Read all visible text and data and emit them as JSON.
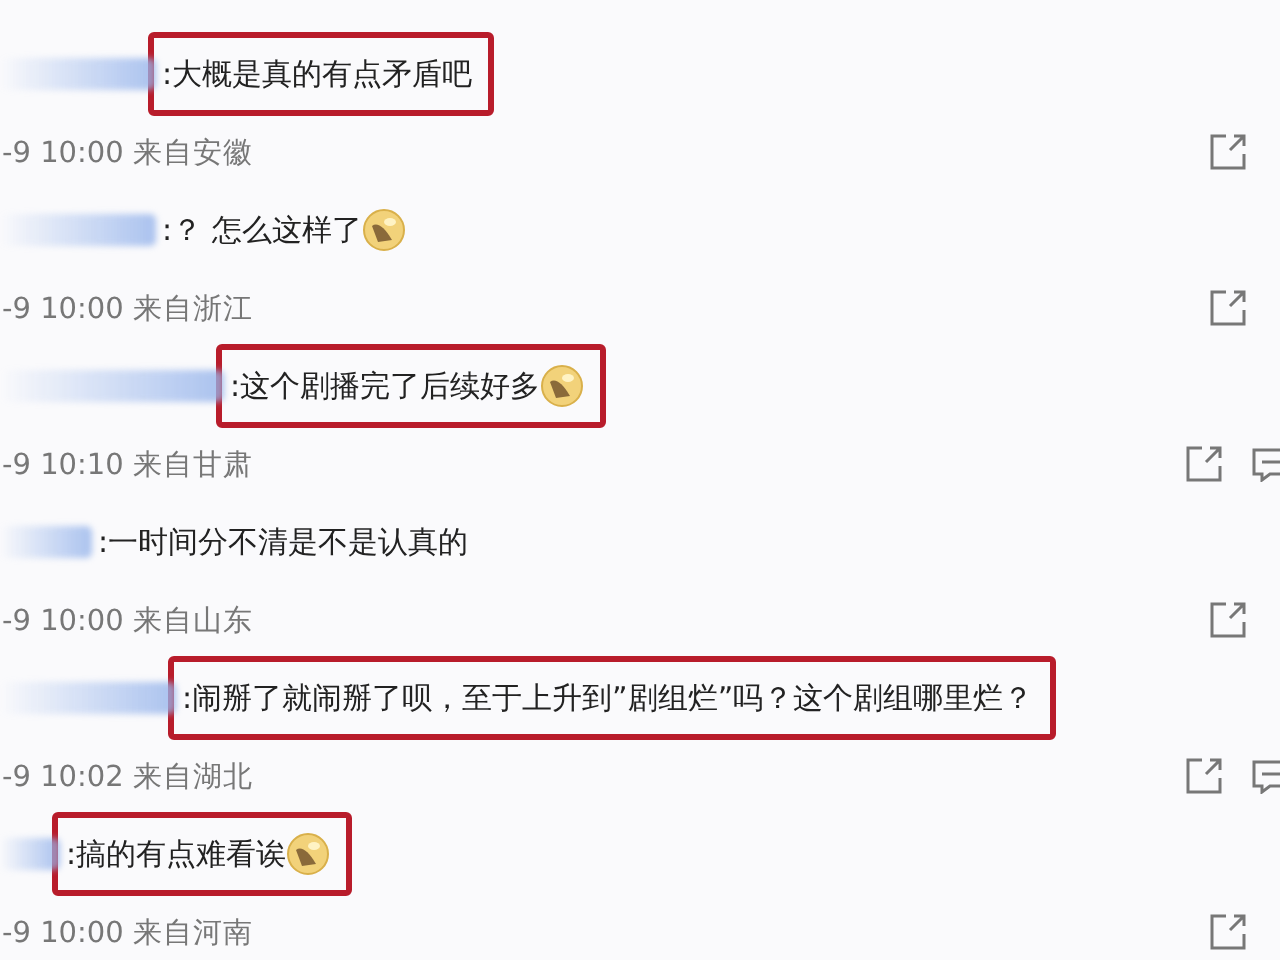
{
  "comments": [
    {
      "text": ":大概是真的有点矛盾吧",
      "emoji": false,
      "highlighted": true,
      "meta": "-9 10:00 来自安徽",
      "reply_icon": false
    },
    {
      "text": ":？ 怎么这样了",
      "emoji": true,
      "highlighted": false,
      "meta": "-9 10:00 来自浙江",
      "reply_icon": false
    },
    {
      "text": ":这个剧播完了后续好多",
      "emoji": true,
      "highlighted": true,
      "meta": "-9 10:10 来自甘肃",
      "reply_icon": true
    },
    {
      "text": ":一时间分不清是不是认真的",
      "emoji": false,
      "highlighted": false,
      "meta": "-9 10:00 来自山东",
      "reply_icon": false
    },
    {
      "text": ":闹掰了就闹掰了呗，至于上升到”剧组烂”吗？这个剧组哪里烂？",
      "emoji": false,
      "highlighted": true,
      "meta": "-9 10:02 来自湖北",
      "reply_icon": true
    },
    {
      "text": ":搞的有点难看诶",
      "emoji": true,
      "highlighted": true,
      "meta": "-9 10:00 来自河南",
      "reply_icon": false
    }
  ]
}
